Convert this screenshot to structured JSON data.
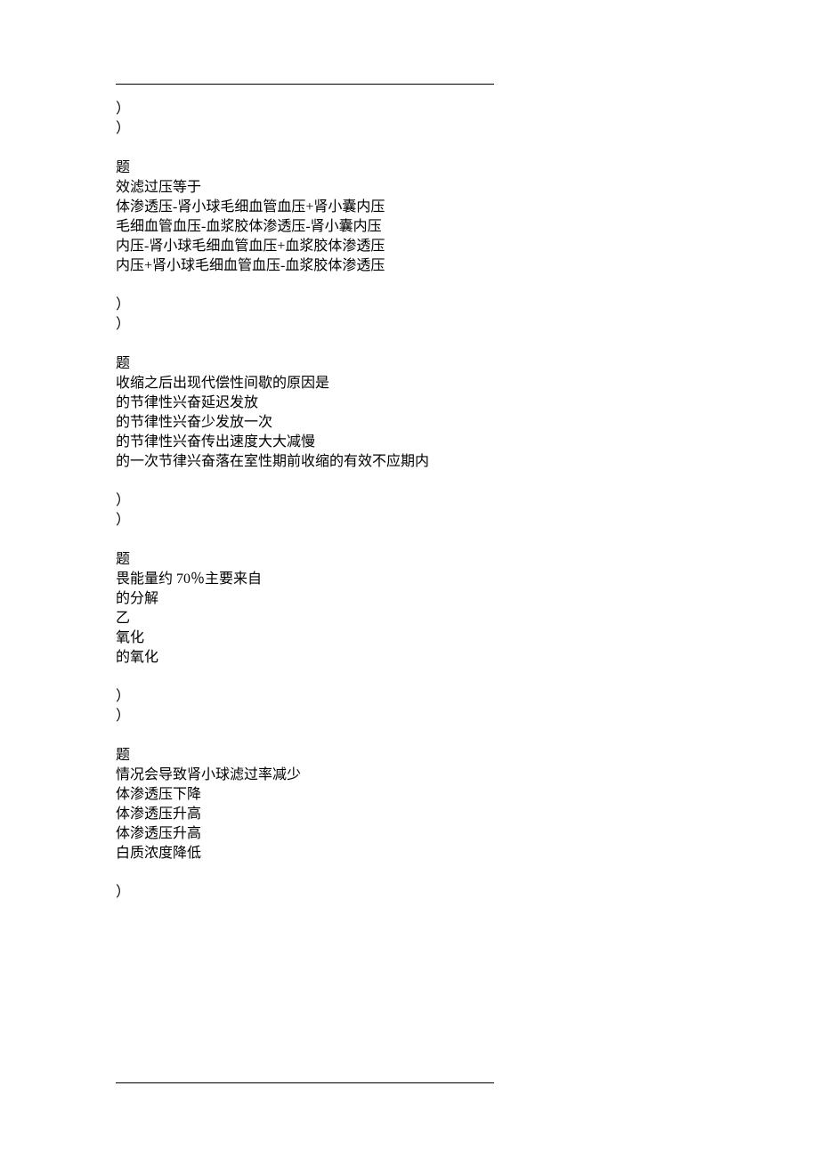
{
  "lines": [
    "）",
    "）",
    "",
    "题",
    "效滤过压等于",
    "体渗透压-肾小球毛细血管血压+肾小囊内压",
    "毛细血管血压-血浆胶体渗透压-肾小囊内压",
    "内压-肾小球毛细血管血压+血浆胶体渗透压",
    "内压+肾小球毛细血管血压-血浆胶体渗透压",
    "",
    "）",
    "）",
    "",
    "题",
    "收缩之后出现代偿性间歇的原因是",
    "的节律性兴奋延迟发放",
    "的节律性兴奋少发放一次",
    "的节律性兴奋传出速度大大减慢",
    "的一次节律兴奋落在室性期前收缩的有效不应期内",
    "",
    "）",
    "）",
    "",
    "题",
    "畏能量约 70％主要来自",
    "的分解",
    "乙",
    "氧化",
    "的氧化",
    "",
    "）",
    "）",
    "",
    "题",
    "情况会导致肾小球滤过率减少",
    "体渗透压下降",
    "体渗透压升高",
    "体渗透压升高",
    "白质浓度降低",
    "",
    "）"
  ]
}
